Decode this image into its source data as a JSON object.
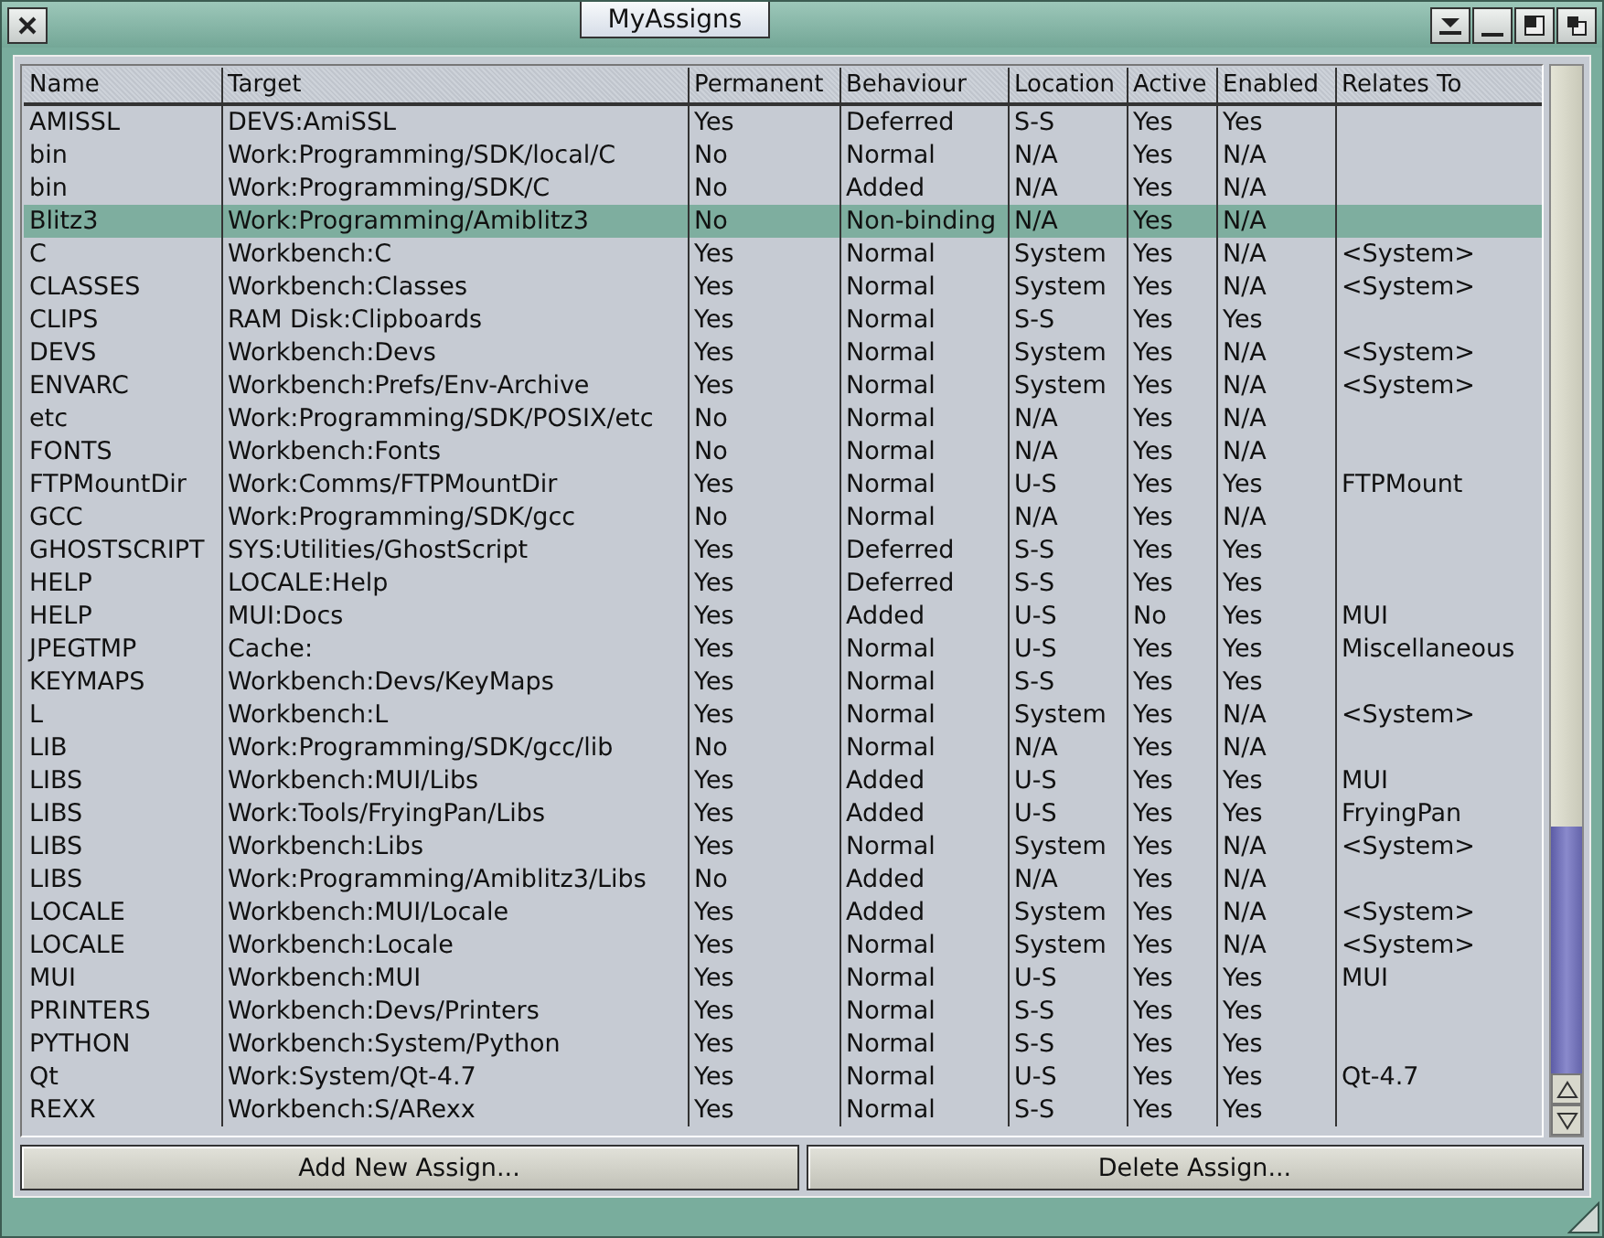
{
  "window": {
    "title": "MyAssigns"
  },
  "table": {
    "columns": [
      "Name",
      "Target",
      "Permanent",
      "Behaviour",
      "Location",
      "Active",
      "Enabled",
      "Relates To"
    ],
    "rows": [
      {
        "cells": [
          "AMISSL",
          "DEVS:AmiSSL",
          "Yes",
          "Deferred",
          "S-S",
          "Yes",
          "Yes",
          ""
        ],
        "selected": false
      },
      {
        "cells": [
          "bin",
          "Work:Programming/SDK/local/C",
          "No",
          "Normal",
          "N/A",
          "Yes",
          "N/A",
          ""
        ],
        "selected": false
      },
      {
        "cells": [
          "bin",
          "Work:Programming/SDK/C",
          "No",
          "Added",
          "N/A",
          "Yes",
          "N/A",
          ""
        ],
        "selected": false
      },
      {
        "cells": [
          "Blitz3",
          "Work:Programming/Amiblitz3",
          "No",
          "Non-binding",
          "N/A",
          "Yes",
          "N/A",
          ""
        ],
        "selected": true
      },
      {
        "cells": [
          "C",
          "Workbench:C",
          "Yes",
          "Normal",
          "System",
          "Yes",
          "N/A",
          "<System>"
        ],
        "selected": false
      },
      {
        "cells": [
          "CLASSES",
          "Workbench:Classes",
          "Yes",
          "Normal",
          "System",
          "Yes",
          "N/A",
          "<System>"
        ],
        "selected": false
      },
      {
        "cells": [
          "CLIPS",
          "RAM Disk:Clipboards",
          "Yes",
          "Normal",
          "S-S",
          "Yes",
          "Yes",
          ""
        ],
        "selected": false
      },
      {
        "cells": [
          "DEVS",
          "Workbench:Devs",
          "Yes",
          "Normal",
          "System",
          "Yes",
          "N/A",
          "<System>"
        ],
        "selected": false
      },
      {
        "cells": [
          "ENVARC",
          "Workbench:Prefs/Env-Archive",
          "Yes",
          "Normal",
          "System",
          "Yes",
          "N/A",
          "<System>"
        ],
        "selected": false
      },
      {
        "cells": [
          "etc",
          "Work:Programming/SDK/POSIX/etc",
          "No",
          "Normal",
          "N/A",
          "Yes",
          "N/A",
          ""
        ],
        "selected": false
      },
      {
        "cells": [
          "FONTS",
          "Workbench:Fonts",
          "No",
          "Normal",
          "N/A",
          "Yes",
          "N/A",
          ""
        ],
        "selected": false
      },
      {
        "cells": [
          "FTPMountDir",
          "Work:Comms/FTPMountDir",
          "Yes",
          "Normal",
          "U-S",
          "Yes",
          "Yes",
          "FTPMount"
        ],
        "selected": false
      },
      {
        "cells": [
          "GCC",
          "Work:Programming/SDK/gcc",
          "No",
          "Normal",
          "N/A",
          "Yes",
          "N/A",
          ""
        ],
        "selected": false
      },
      {
        "cells": [
          "GHOSTSCRIPT",
          "SYS:Utilities/GhostScript",
          "Yes",
          "Deferred",
          "S-S",
          "Yes",
          "Yes",
          ""
        ],
        "selected": false
      },
      {
        "cells": [
          "HELP",
          "LOCALE:Help",
          "Yes",
          "Deferred",
          "S-S",
          "Yes",
          "Yes",
          ""
        ],
        "selected": false
      },
      {
        "cells": [
          "HELP",
          "MUI:Docs",
          "Yes",
          "Added",
          "U-S",
          "No",
          "Yes",
          "MUI"
        ],
        "selected": false
      },
      {
        "cells": [
          "JPEGTMP",
          "Cache:",
          "Yes",
          "Normal",
          "U-S",
          "Yes",
          "Yes",
          "Miscellaneous"
        ],
        "selected": false
      },
      {
        "cells": [
          "KEYMAPS",
          "Workbench:Devs/KeyMaps",
          "Yes",
          "Normal",
          "S-S",
          "Yes",
          "Yes",
          ""
        ],
        "selected": false
      },
      {
        "cells": [
          "L",
          "Workbench:L",
          "Yes",
          "Normal",
          "System",
          "Yes",
          "N/A",
          "<System>"
        ],
        "selected": false
      },
      {
        "cells": [
          "LIB",
          "Work:Programming/SDK/gcc/lib",
          "No",
          "Normal",
          "N/A",
          "Yes",
          "N/A",
          ""
        ],
        "selected": false
      },
      {
        "cells": [
          "LIBS",
          "Workbench:MUI/Libs",
          "Yes",
          "Added",
          "U-S",
          "Yes",
          "Yes",
          "MUI"
        ],
        "selected": false
      },
      {
        "cells": [
          "LIBS",
          "Work:Tools/FryingPan/Libs",
          "Yes",
          "Added",
          "U-S",
          "Yes",
          "Yes",
          "FryingPan"
        ],
        "selected": false
      },
      {
        "cells": [
          "LIBS",
          "Workbench:Libs",
          "Yes",
          "Normal",
          "System",
          "Yes",
          "N/A",
          "<System>"
        ],
        "selected": false
      },
      {
        "cells": [
          "LIBS",
          "Work:Programming/Amiblitz3/Libs",
          "No",
          "Added",
          "N/A",
          "Yes",
          "N/A",
          ""
        ],
        "selected": false
      },
      {
        "cells": [
          "LOCALE",
          "Workbench:MUI/Locale",
          "Yes",
          "Added",
          "System",
          "Yes",
          "N/A",
          "<System>"
        ],
        "selected": false
      },
      {
        "cells": [
          "LOCALE",
          "Workbench:Locale",
          "Yes",
          "Normal",
          "System",
          "Yes",
          "N/A",
          "<System>"
        ],
        "selected": false
      },
      {
        "cells": [
          "MUI",
          "Workbench:MUI",
          "Yes",
          "Normal",
          "U-S",
          "Yes",
          "Yes",
          "MUI"
        ],
        "selected": false
      },
      {
        "cells": [
          "PRINTERS",
          "Workbench:Devs/Printers",
          "Yes",
          "Normal",
          "S-S",
          "Yes",
          "Yes",
          ""
        ],
        "selected": false
      },
      {
        "cells": [
          "PYTHON",
          "Workbench:System/Python",
          "Yes",
          "Normal",
          "S-S",
          "Yes",
          "Yes",
          ""
        ],
        "selected": false
      },
      {
        "cells": [
          "Qt",
          "Work:System/Qt-4.7",
          "Yes",
          "Normal",
          "U-S",
          "Yes",
          "Yes",
          "Qt-4.7"
        ],
        "selected": false
      },
      {
        "cells": [
          "REXX",
          "Workbench:S/ARexx",
          "Yes",
          "Normal",
          "S-S",
          "Yes",
          "Yes",
          ""
        ],
        "selected": false
      }
    ]
  },
  "buttons": [
    "Add New Assign...",
    "Delete Assign..."
  ]
}
